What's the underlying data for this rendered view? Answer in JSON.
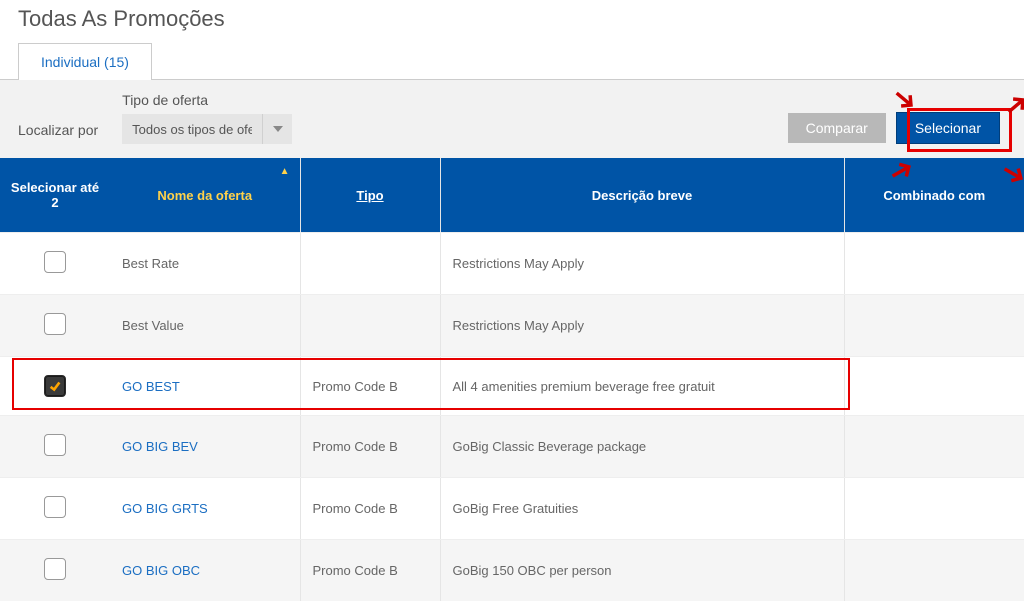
{
  "page_title": "Todas As Promoções",
  "tab": {
    "label": "Individual (15)"
  },
  "filter": {
    "locate_label": "Localizar por",
    "type_label": "Tipo de oferta",
    "select_value": "Todos os tipos de ofe"
  },
  "buttons": {
    "compare": "Comparar",
    "select": "Selecionar"
  },
  "columns": {
    "select": "Selecionar até 2",
    "name": "Nome da oferta",
    "type": "Tipo",
    "desc": "Descrição breve",
    "combined": "Combinado com"
  },
  "rows": [
    {
      "checked": false,
      "name": "Best Rate",
      "link": false,
      "type": "",
      "desc": "Restrictions May Apply",
      "alt": false
    },
    {
      "checked": false,
      "name": "Best Value",
      "link": false,
      "type": "",
      "desc": "Restrictions May Apply",
      "alt": true
    },
    {
      "checked": true,
      "name": "GO BEST",
      "link": true,
      "type": "Promo Code B",
      "desc": "All 4 amenities premium beverage free gratuit",
      "alt": false
    },
    {
      "checked": false,
      "name": "GO BIG BEV",
      "link": true,
      "type": "Promo Code B",
      "desc": "GoBig Classic Beverage package",
      "alt": true
    },
    {
      "checked": false,
      "name": "GO BIG GRTS",
      "link": true,
      "type": "Promo Code B",
      "desc": "GoBig Free Gratuities",
      "alt": false
    },
    {
      "checked": false,
      "name": "GO BIG OBC",
      "link": true,
      "type": "Promo Code B",
      "desc": "GoBig 150 OBC per person",
      "alt": true
    }
  ]
}
